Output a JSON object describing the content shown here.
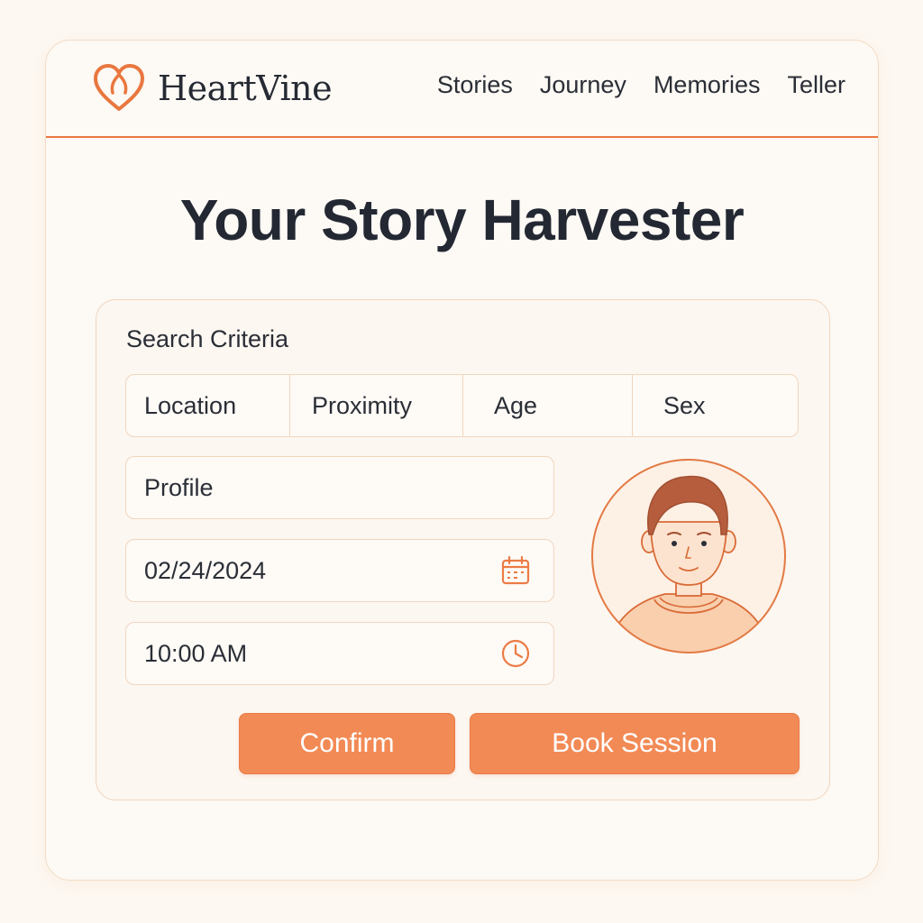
{
  "brand": {
    "name": "HeartVine",
    "logo_icon": "heart-logo-icon"
  },
  "nav": {
    "items": [
      {
        "label": "Stories"
      },
      {
        "label": "Journey"
      },
      {
        "label": "Memories"
      },
      {
        "label": "Teller"
      }
    ]
  },
  "page": {
    "title": "Your Story Harvester"
  },
  "search": {
    "title": "Search Criteria",
    "filters": [
      {
        "label": "Location"
      },
      {
        "label": "Proximity"
      },
      {
        "label": "Age"
      },
      {
        "label": "Sex"
      }
    ],
    "profile": {
      "value": "Profile"
    },
    "date": {
      "value": "02/24/2024",
      "icon": "calendar-icon"
    },
    "time": {
      "value": "10:00 AM",
      "icon": "clock-icon"
    },
    "avatar_icon": "person-avatar-icon"
  },
  "actions": {
    "confirm_label": "Confirm",
    "book_label": "Book Session"
  },
  "colors": {
    "accent": "#f28a55",
    "accent_line": "#e9773f",
    "background": "#fdf8f2",
    "border": "#f1d6bd",
    "text": "#2a2e36"
  }
}
